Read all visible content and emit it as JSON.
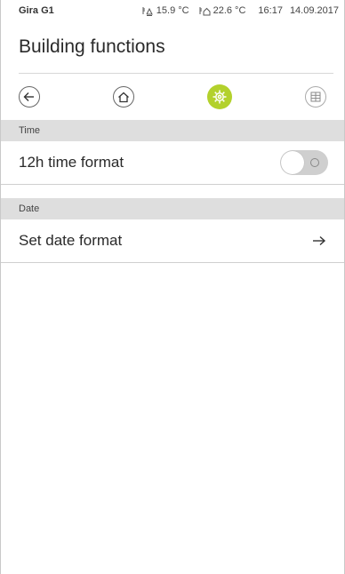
{
  "statusbar": {
    "brand": "Gira G1",
    "outdoor_temp": "15.9 °C",
    "indoor_temp": "22.6 °C",
    "time": "16:17",
    "date": "14.09.2017"
  },
  "page": {
    "title": "Building functions"
  },
  "navbar": {
    "icons": [
      "back-arrow-icon",
      "home-icon",
      "settings-gear-icon",
      "grid-icon"
    ],
    "accent_color": "#b3d12c"
  },
  "sections": {
    "time": {
      "header": "Time",
      "row_label": "12h time format",
      "toggle_state": "off"
    },
    "date": {
      "header": "Date",
      "row_label": "Set date format",
      "row_icon": "arrow-right-icon"
    }
  }
}
